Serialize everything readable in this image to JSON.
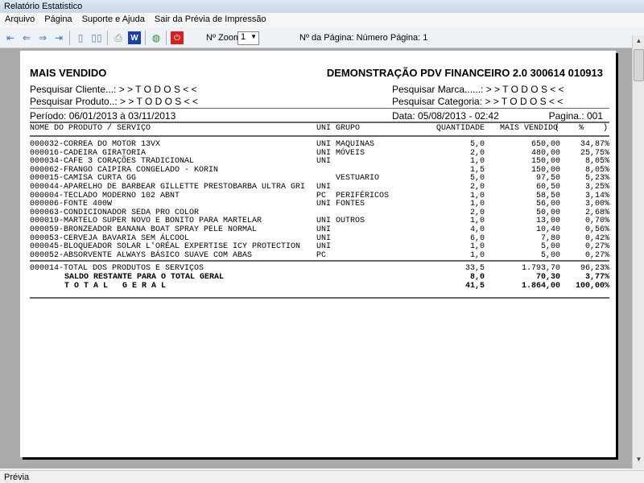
{
  "window": {
    "title": "Relatório Estatistico"
  },
  "menu": [
    "Arquivo",
    "Página",
    "Suporte e Ajuda",
    "Sair da Prévia de Impressão"
  ],
  "toolbar": {
    "zoom_label": "Nº Zoom",
    "zoom_value": "1",
    "page_label": "Nº da Página: Número Página: 1"
  },
  "report": {
    "title_left": "MAIS VENDIDO",
    "title_right": "DEMONSTRAÇÃO PDV FINANCEIRO 2.0 300614 010913",
    "filter_cliente": "Pesquisar Cliente...: > > T O D O S < <",
    "filter_produto": "Pesquisar Produto..: > > T O D O S < <",
    "filter_marca": "Pesquisar Marca......: > > T O D O S < <",
    "filter_categoria": "Pesquisar Categoria: > > T O D O S < <",
    "periodo": "Período: 06/01/2013 à 03/11/2013",
    "data": "Data: 05/08/2013 - 02:42",
    "pagina": "Pagina.: 001",
    "headers": {
      "nome": "NOME DO PRODUTO / SERVIÇO",
      "uni": "UNI",
      "grupo": "GRUPO",
      "qtd": "QUANTIDADE",
      "valor": "MAIS VENDIDO",
      "pct": "(    %    )"
    },
    "rows": [
      {
        "nome": "000032-CORREA DO MOTOR 13VX",
        "uni": "UNI",
        "grupo": "MAQUINAS",
        "qtd": "5,0",
        "valor": "650,00",
        "pct": "34,87%"
      },
      {
        "nome": "000016-CADEIRA GIRATORIA",
        "uni": "UNI",
        "grupo": "MÓVEIS",
        "qtd": "2,0",
        "valor": "480,00",
        "pct": "25,75%"
      },
      {
        "nome": "000034-CAFE 3 CORAÇÕES TRADICIONAL",
        "uni": "UNI",
        "grupo": "",
        "qtd": "1,0",
        "valor": "150,00",
        "pct": "8,05%"
      },
      {
        "nome": "000062-FRANGO CAIPIRA CONGELADO - KORIN",
        "uni": "",
        "grupo": "",
        "qtd": "1,5",
        "valor": "150,00",
        "pct": "8,05%"
      },
      {
        "nome": "000015-CAMISA CURTA GG",
        "uni": "",
        "grupo": "VESTUARIO",
        "qtd": "5,0",
        "valor": "97,50",
        "pct": "5,23%"
      },
      {
        "nome": "000044-APARELHO DE BARBEAR GILLETTE PRESTOBARBA ULTRA GRI",
        "uni": "UNI",
        "grupo": "",
        "qtd": "2,0",
        "valor": "60,50",
        "pct": "3,25%"
      },
      {
        "nome": "000004-TECLADO MODERNO 102 ABNT",
        "uni": "PC",
        "grupo": "PERIFÉRICOS",
        "qtd": "1,0",
        "valor": "58,50",
        "pct": "3,14%"
      },
      {
        "nome": "000006-FONTE 400W",
        "uni": "UNI",
        "grupo": "FONTES",
        "qtd": "1,0",
        "valor": "56,00",
        "pct": "3,00%"
      },
      {
        "nome": "000063-CONDICIONADOR SEDA PRO COLOR",
        "uni": "",
        "grupo": "",
        "qtd": "2,0",
        "valor": "50,00",
        "pct": "2,68%"
      },
      {
        "nome": "000019-MARTELO SUPER NOVO E BONITO PARA MARTELAR",
        "uni": "UNI",
        "grupo": "OUTROS",
        "qtd": "1,0",
        "valor": "13,00",
        "pct": "0,70%"
      },
      {
        "nome": "000059-BRONZEADOR BANANA BOAT SPRAY PELE NORMAL",
        "uni": "UNI",
        "grupo": "",
        "qtd": "4,0",
        "valor": "10,40",
        "pct": "0,56%"
      },
      {
        "nome": "000053-CERVEJA BAVARIA SEM ÁLCOOL",
        "uni": "UNI",
        "grupo": "",
        "qtd": "6,0",
        "valor": "7,80",
        "pct": "0,42%"
      },
      {
        "nome": "000045-BLOQUEADOR SOLAR L'ORÉAL EXPERTISE ICY PROTECTION",
        "uni": "UNI",
        "grupo": "",
        "qtd": "1,0",
        "valor": "5,00",
        "pct": "0,27%"
      },
      {
        "nome": "000052-ABSORVENTE ALWAYS BÁSICO SUAVE COM ABAS",
        "uni": "PC",
        "grupo": "",
        "qtd": "1,0",
        "valor": "5,00",
        "pct": "0,27%"
      }
    ],
    "totals": [
      {
        "label": "000014-TOTAL DOS PRODUTOS E SERVIÇOS",
        "qtd": "33,5",
        "valor": "1.793,70",
        "pct": "96,23%"
      },
      {
        "label": "SALDO RESTANTE PARA O TOTAL GERAL",
        "qtd": "8,0",
        "valor": "70,30",
        "pct": "3,77%"
      },
      {
        "label": "T O T A L   G E R A L",
        "qtd": "41,5",
        "valor": "1.864,00",
        "pct": "100,00%"
      }
    ]
  },
  "status": "Prévia"
}
